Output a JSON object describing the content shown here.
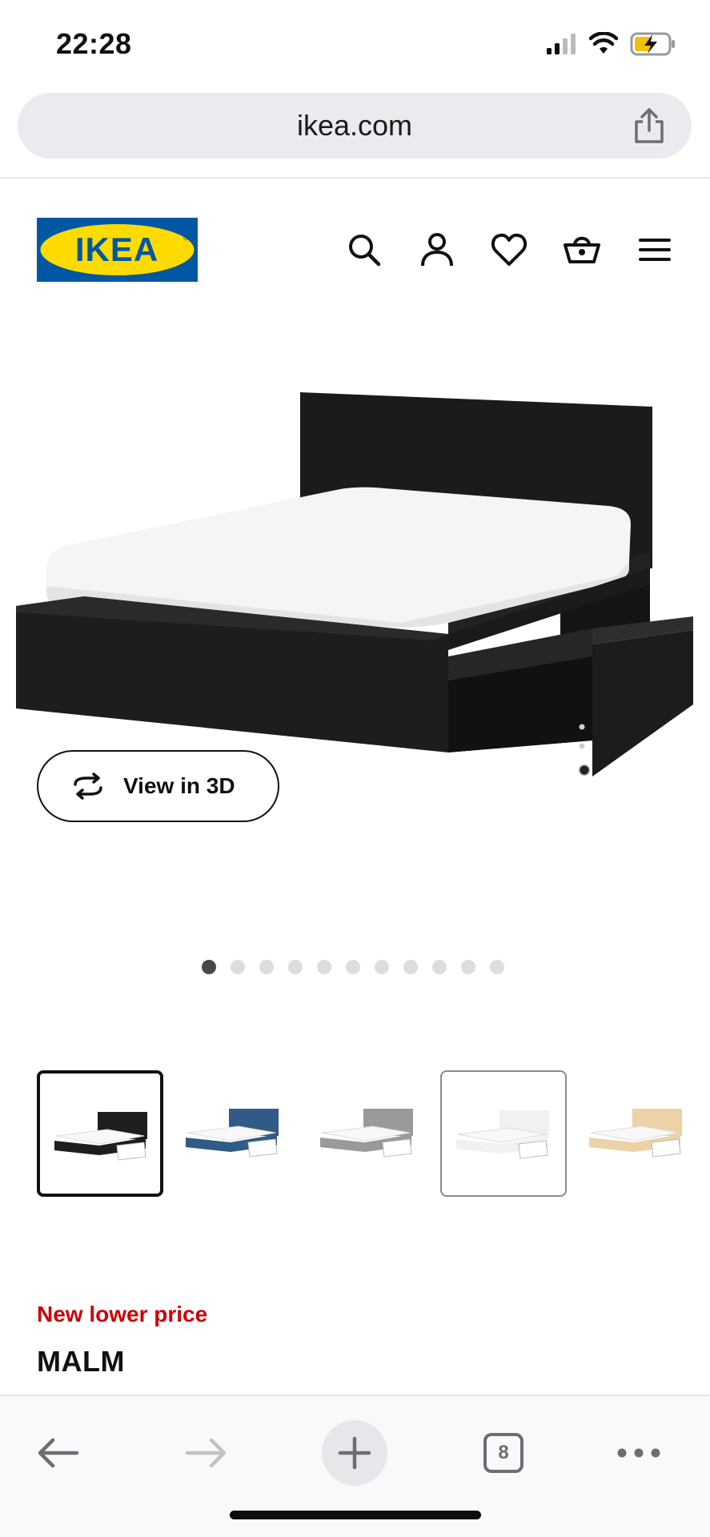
{
  "status": {
    "time": "22:28"
  },
  "browser": {
    "url": "ikea.com",
    "tab_count": "8"
  },
  "brand": {
    "logo_text": "IKEA",
    "colors": {
      "blue": "#0058a3",
      "yellow": "#ffdb00"
    }
  },
  "header_icons": [
    "search-icon",
    "account-icon",
    "heart-icon",
    "basket-icon",
    "menu-icon"
  ],
  "product": {
    "view3d_label": "View in 3D",
    "gallery_count": 11,
    "gallery_active_index": 0,
    "variants": [
      {
        "name": "black-brown",
        "color": "#1e1e1e",
        "selected": true
      },
      {
        "name": "blue",
        "color": "#2f5b86",
        "selected": false
      },
      {
        "name": "grey",
        "color": "#9a9a9a",
        "selected": false
      },
      {
        "name": "white",
        "color": "#f1f1f1",
        "selected": false
      },
      {
        "name": "oak",
        "color": "#ecd2a6",
        "selected": false
      }
    ],
    "badge": "New lower price",
    "name": "MALM",
    "accent_color": "#cc0008"
  }
}
